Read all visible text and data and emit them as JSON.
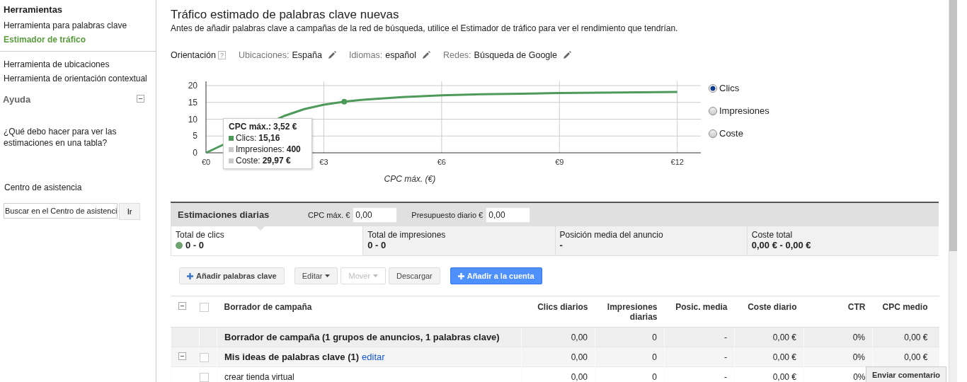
{
  "sidebar": {
    "title": "Herramientas",
    "tool_groups": [
      {
        "items": [
          {
            "label": "Herramienta para palabras clave",
            "selected": false
          },
          {
            "label": "Estimador de tráfico",
            "selected": true
          }
        ]
      },
      {
        "items": [
          {
            "label": "Herramienta de ubicaciones",
            "selected": false
          },
          {
            "label": "Herramienta de orientación contextual",
            "selected": false
          }
        ]
      }
    ],
    "help": {
      "title": "Ayuda",
      "expanded": true,
      "question": "¿Qué debo hacer para ver las estimaciones en una tabla?",
      "link": "Centro de asistencia",
      "search_value": "Buscar en el Centro de asistenci",
      "search_button": "Ir"
    }
  },
  "main": {
    "title": "Tráfico estimado de palabras clave nuevas",
    "subtitle": "Antes de añadir palabras clave a campañas de la red de búsqueda, utilice el Estimador de tráfico para ver el rendimiento que tendrían.",
    "targeting": {
      "label": "Orientación",
      "help": "?",
      "items": [
        {
          "label": "Ubicaciones:",
          "value": "España"
        },
        {
          "label": "Idiomas:",
          "value": "español"
        },
        {
          "label": "Redes:",
          "value": "Búsqueda de Google"
        }
      ]
    },
    "chart": {
      "chart_data": {
        "type": "line",
        "xlabel": "CPC máx. (€)",
        "x": [
          0,
          2,
          2.5,
          3,
          3.52,
          4,
          5,
          6,
          7,
          8,
          9,
          10,
          11,
          12
        ],
        "series": [
          {
            "color": "#4e9a5a",
            "values": [
              0,
              11,
              13,
              14.3,
              15.2,
              15.8,
              16.6,
              17.1,
              17.4,
              17.6,
              17.8,
              17.9,
              18,
              18.1
            ]
          }
        ],
        "grid": true,
        "xlim": [
          0,
          12.6
        ],
        "ylim": [
          0,
          20
        ],
        "xticks": [
          {
            "value": 0,
            "label": "€0"
          },
          {
            "value": 3,
            "label": "€3"
          },
          {
            "value": 6,
            "label": "€6"
          },
          {
            "value": 9,
            "label": "€9"
          },
          {
            "value": 12,
            "label": "€12"
          }
        ],
        "yticks": [
          0,
          5,
          10,
          15,
          20
        ]
      },
      "tooltip": {
        "title_label": "CPC máx.:",
        "title_value": "3,52 €",
        "rows": [
          {
            "label": "Clics:",
            "value": "15,16",
            "color": "#4e9a5a"
          },
          {
            "label": "Impresiones:",
            "value": "400",
            "color": "#c8c8c8"
          },
          {
            "label": "Coste:",
            "value": "29,97 €",
            "color": "#c8c8c8"
          }
        ]
      },
      "metric_options": [
        {
          "label": "Clics",
          "selected": true
        },
        {
          "label": "Impresiones",
          "selected": false
        },
        {
          "label": "Coste",
          "selected": false
        }
      ]
    },
    "estimates": {
      "title": "Estimaciones diarias",
      "fields": [
        {
          "label": "CPC máx. €",
          "value": "0,00"
        },
        {
          "label": "Presupuesto diario €",
          "value": "0,00"
        }
      ],
      "metrics": [
        {
          "label": "Total de clics",
          "value": "0 - 0",
          "selected": true,
          "color": "#6fa271"
        },
        {
          "label": "Total de impresiones",
          "value": "0 - 0",
          "selected": false
        },
        {
          "label": "Posición media del anuncio",
          "value": "-",
          "selected": false
        },
        {
          "label": "Coste total",
          "value": "0,00 € - 0,00 €",
          "selected": false
        }
      ]
    },
    "buttons": [
      {
        "label": "Añadir palabras clave",
        "kind": "add",
        "disabled": false
      },
      {
        "label": "Editar",
        "kind": "dropdown",
        "disabled": false
      },
      {
        "label": "Mover",
        "kind": "dropdown",
        "disabled": true
      },
      {
        "label": "Descargar",
        "kind": "plain",
        "disabled": false
      },
      {
        "label": "Añadir a la cuenta",
        "kind": "primary",
        "disabled": false
      }
    ],
    "table": {
      "expanded": true,
      "checked": false,
      "columns": [
        "Borrador de campaña",
        "Clics diarios",
        "Impresiones diarias",
        "Posic. media",
        "Coste diario",
        "CTR",
        "CPC medio"
      ],
      "rows": [
        {
          "kind": "campaign",
          "cells": [
            "Borrador de campaña (1 grupos de anuncios, 1 palabras clave)",
            "0,00",
            "0",
            "-",
            "0,00 €",
            "0%",
            "0,00 €"
          ]
        },
        {
          "kind": "adgroup",
          "link": "editar",
          "expanded": true,
          "checked": false,
          "cells": [
            "Mis ideas de palabras clave (1)",
            "0,00",
            "0",
            "-",
            "0,00 €",
            "0%",
            "0,00 €"
          ]
        },
        {
          "kind": "keyword",
          "checked": false,
          "cells": [
            "crear tienda virtual",
            "0,00",
            "0",
            "-",
            "0,00 €",
            "0%"
          ]
        }
      ]
    }
  },
  "feedback_button": "Enviar comentario"
}
